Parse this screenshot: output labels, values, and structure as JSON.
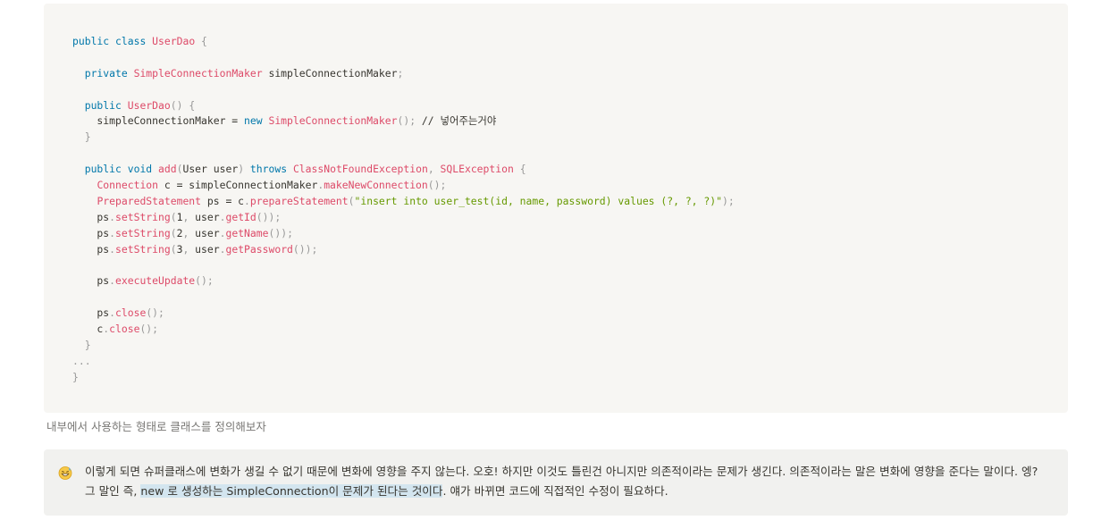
{
  "code": {
    "language": "java",
    "lines": [
      [
        [
          "kw",
          "public"
        ],
        [
          "",
          " "
        ],
        [
          "kw",
          "class"
        ],
        [
          "",
          " "
        ],
        [
          "ty",
          "UserDao"
        ],
        [
          "",
          " "
        ],
        [
          "pn",
          "{"
        ]
      ],
      [],
      [
        [
          "",
          "  "
        ],
        [
          "kw",
          "private"
        ],
        [
          "",
          " "
        ],
        [
          "ty",
          "SimpleConnectionMaker"
        ],
        [
          "",
          " simpleConnectionMaker"
        ],
        [
          "pn",
          ";"
        ]
      ],
      [],
      [
        [
          "",
          "  "
        ],
        [
          "kw",
          "public"
        ],
        [
          "",
          " "
        ],
        [
          "fn",
          "UserDao"
        ],
        [
          "pn",
          "() {"
        ]
      ],
      [
        [
          "",
          "    simpleConnectionMaker = "
        ],
        [
          "kw",
          "new"
        ],
        [
          "",
          " "
        ],
        [
          "fn",
          "SimpleConnectionMaker"
        ],
        [
          "pn",
          "();"
        ],
        [
          "",
          " // 넣어주는거야"
        ]
      ],
      [
        [
          "",
          "  "
        ],
        [
          "pn",
          "}"
        ]
      ],
      [],
      [
        [
          "",
          "  "
        ],
        [
          "kw",
          "public"
        ],
        [
          "",
          " "
        ],
        [
          "kw",
          "void"
        ],
        [
          "",
          " "
        ],
        [
          "fn",
          "add"
        ],
        [
          "pn",
          "("
        ],
        [
          "",
          "User user"
        ],
        [
          "pn",
          ")"
        ],
        [
          "",
          " "
        ],
        [
          "kw",
          "throws"
        ],
        [
          "",
          " "
        ],
        [
          "ty",
          "ClassNotFoundException"
        ],
        [
          "pn",
          ","
        ],
        [
          "",
          " "
        ],
        [
          "ty",
          "SQLException"
        ],
        [
          "",
          " "
        ],
        [
          "pn",
          "{"
        ]
      ],
      [
        [
          "",
          "    "
        ],
        [
          "ty",
          "Connection"
        ],
        [
          "",
          " c = simpleConnectionMaker"
        ],
        [
          "pn",
          "."
        ],
        [
          "fn",
          "makeNewConnection"
        ],
        [
          "pn",
          "();"
        ]
      ],
      [
        [
          "",
          "    "
        ],
        [
          "ty",
          "PreparedStatement"
        ],
        [
          "",
          " ps = c"
        ],
        [
          "pn",
          "."
        ],
        [
          "fn",
          "prepareStatement"
        ],
        [
          "pn",
          "("
        ],
        [
          "str",
          "\"insert into user_test(id, name, password) values (?, ?, ?)\""
        ],
        [
          "pn",
          ");"
        ]
      ],
      [
        [
          "",
          "    ps"
        ],
        [
          "pn",
          "."
        ],
        [
          "fn",
          "setString"
        ],
        [
          "pn",
          "("
        ],
        [
          "",
          "1"
        ],
        [
          "pn",
          ","
        ],
        [
          "",
          " user"
        ],
        [
          "pn",
          "."
        ],
        [
          "fn",
          "getId"
        ],
        [
          "pn",
          "());"
        ]
      ],
      [
        [
          "",
          "    ps"
        ],
        [
          "pn",
          "."
        ],
        [
          "fn",
          "setString"
        ],
        [
          "pn",
          "("
        ],
        [
          "",
          "2"
        ],
        [
          "pn",
          ","
        ],
        [
          "",
          " user"
        ],
        [
          "pn",
          "."
        ],
        [
          "fn",
          "getName"
        ],
        [
          "pn",
          "());"
        ]
      ],
      [
        [
          "",
          "    ps"
        ],
        [
          "pn",
          "."
        ],
        [
          "fn",
          "setString"
        ],
        [
          "pn",
          "("
        ],
        [
          "",
          "3"
        ],
        [
          "pn",
          ","
        ],
        [
          "",
          " user"
        ],
        [
          "pn",
          "."
        ],
        [
          "fn",
          "getPassword"
        ],
        [
          "pn",
          "());"
        ]
      ],
      [],
      [
        [
          "",
          "    ps"
        ],
        [
          "pn",
          "."
        ],
        [
          "fn",
          "executeUpdate"
        ],
        [
          "pn",
          "();"
        ]
      ],
      [],
      [
        [
          "",
          "    ps"
        ],
        [
          "pn",
          "."
        ],
        [
          "fn",
          "close"
        ],
        [
          "pn",
          "();"
        ]
      ],
      [
        [
          "",
          "    c"
        ],
        [
          "pn",
          "."
        ],
        [
          "fn",
          "close"
        ],
        [
          "pn",
          "();"
        ]
      ],
      [
        [
          "",
          "  "
        ],
        [
          "pn",
          "}"
        ]
      ],
      [
        [
          "pn",
          "..."
        ]
      ],
      [
        [
          "pn",
          "}"
        ]
      ]
    ]
  },
  "caption": "내부에서 사용하는 형태로 클래스를 정의해보자",
  "callout": {
    "icon": "grinning-sweat-emoji-icon",
    "text_before": "이렇게 되면 슈퍼클래스에 변화가 생길 수 없기 때문에 변화에 영향을 주지 않는다. 오호! 하지만 이것도 틀린건 아니지만 의존적이라는 문제가 생긴다. 의존적이라는 말은 변화에 영향을 준다는 말이다. 엥? 그 말인 즉, ",
    "text_highlight": "new 로 생성하는 SimpleConnection이 문제가 된다는 것이다",
    "text_after": ". 얘가 바뀌면 코드에 직접적인 수정이 필요하다.",
    "highlight_color": "#d3e5ef"
  },
  "colors": {
    "code_background": "#f7f6f3",
    "callout_background": "#f1f1ef",
    "keyword": "#0077aa",
    "type": "#dd4a68",
    "string": "#669900",
    "punctuation": "#999999"
  }
}
